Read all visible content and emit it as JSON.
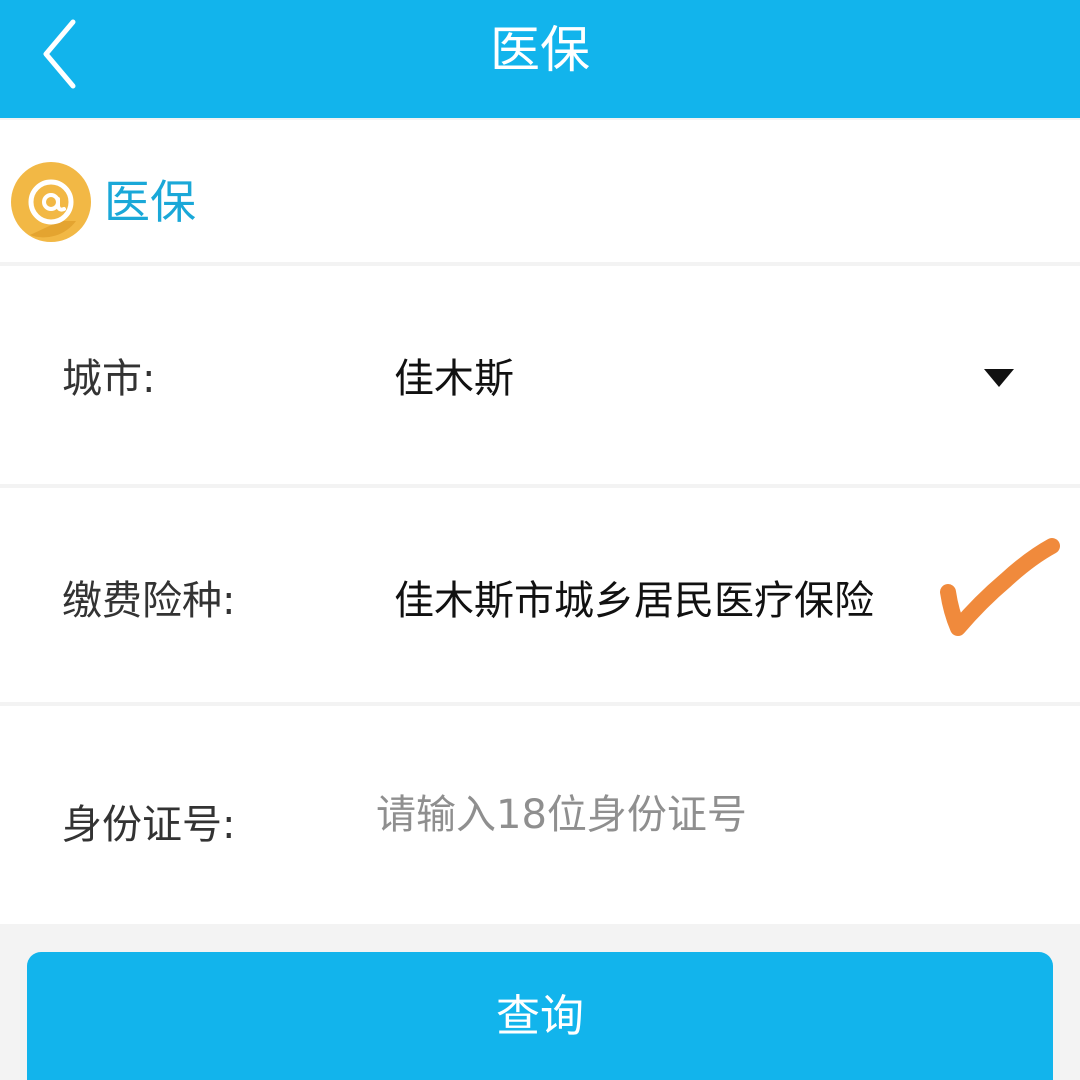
{
  "header": {
    "title": "医保",
    "background_color": "#12b4ec",
    "back_icon": "chevron-left-icon"
  },
  "section": {
    "title": "医保",
    "title_color": "#1aa8d8",
    "icon": "at-sign-badge-icon",
    "icon_color": "#f2b845"
  },
  "form": {
    "city": {
      "label": "城市:",
      "value": "佳木斯",
      "dropdown_icon": "triangle-down-icon"
    },
    "insurance_type": {
      "label": "缴费险种:",
      "value": "佳木斯市城乡居民医疗保险",
      "check_icon": "handwritten-check-icon",
      "check_color": "#f08a3c"
    },
    "id_number": {
      "label": "身份证号:",
      "value": "",
      "placeholder": "请输入18位身份证号"
    }
  },
  "actions": {
    "query_label": "查询",
    "button_color": "#12b4ec"
  }
}
